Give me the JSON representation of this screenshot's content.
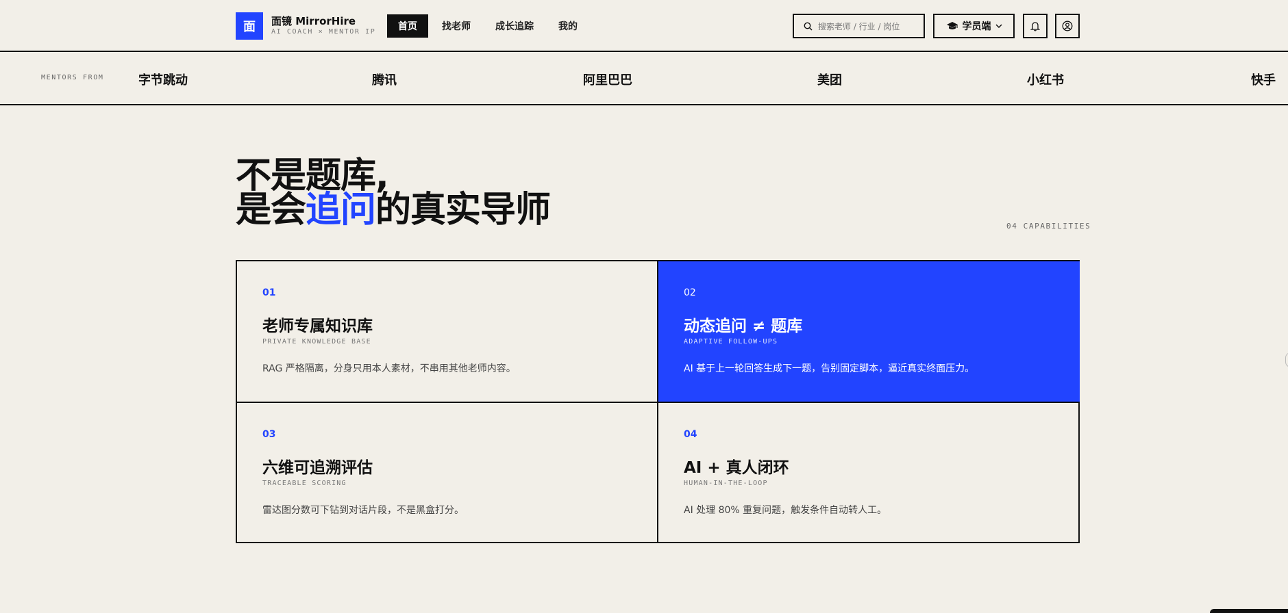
{
  "header": {
    "logo_char": "面",
    "brand_name": "面镜 MirrorHire",
    "brand_tagline": "AI COACH × MENTOR IP",
    "nav": [
      {
        "label": "首页",
        "active": true
      },
      {
        "label": "找老师",
        "active": false
      },
      {
        "label": "成长追踪",
        "active": false
      },
      {
        "label": "我的",
        "active": false
      }
    ],
    "search_placeholder": "搜索老师 / 行业 / 岗位",
    "role_label": "学员端",
    "role_icon": "graduation-cap-icon"
  },
  "mentors": {
    "label": "MENTORS FROM",
    "companies": [
      "字节跳动",
      "腾讯",
      "阿里巴巴",
      "美团",
      "小红书",
      "快手"
    ]
  },
  "hero": {
    "line1": "不是题库,",
    "line2_pre": "是会",
    "line2_accent": "追问",
    "line2_post": "的真实导师",
    "capabilities_count": "04 CAPABILITIES"
  },
  "features": [
    {
      "num": "01",
      "title": "老师专属知识库",
      "subtitle": "PRIVATE KNOWLEDGE BASE",
      "desc": "RAG 严格隔离，分身只用本人素材，不串用其他老师内容。",
      "highlighted": false
    },
    {
      "num": "02",
      "title": "动态追问 ≠ 题库",
      "subtitle": "ADAPTIVE FOLLOW-UPS",
      "desc": "AI 基于上一轮回答生成下一题，告别固定脚本，逼近真实终面压力。",
      "highlighted": true
    },
    {
      "num": "03",
      "title": "六维可追溯评估",
      "subtitle": "TRACEABLE SCORING",
      "desc": "雷达图分数可下钻到对话片段，不是黑盒打分。",
      "highlighted": false
    },
    {
      "num": "04",
      "title": "AI + 真人闭环",
      "subtitle": "HUMAN-IN-THE-LOOP",
      "desc": "AI 处理 80% 重复问题，触发条件自动转人工。",
      "highlighted": false
    }
  ],
  "colors": {
    "accent": "#2244ff",
    "background": "#f2efe8",
    "ink": "#111111"
  }
}
